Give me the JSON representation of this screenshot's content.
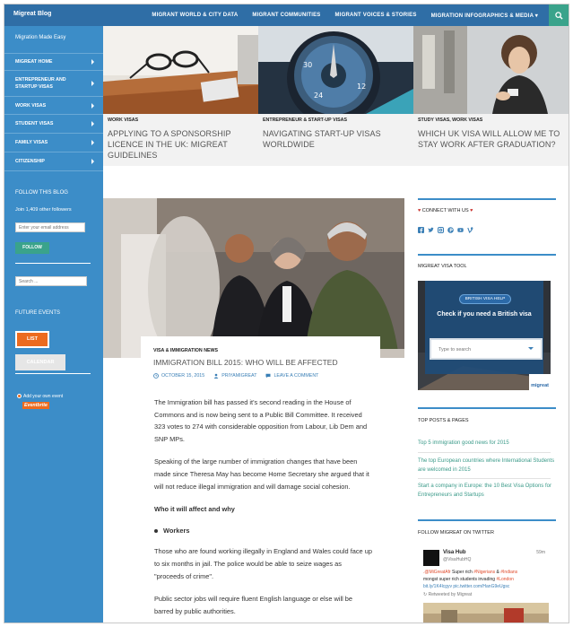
{
  "site": {
    "title": "Migreat Blog",
    "tagline": "Migration Made Easy"
  },
  "top_nav": [
    {
      "label": "MIGRANT WORLD & CITY DATA"
    },
    {
      "label": "MIGRANT COMMUNITIES"
    },
    {
      "label": "MIGRANT VOICES & STORIES"
    },
    {
      "label": "MIGRATION INFOGRAPHICS & MEDIA"
    }
  ],
  "side_menu": [
    {
      "label": "MIGREAT HOME"
    },
    {
      "label": "ENTREPRENEUR AND STARTUP VISAS"
    },
    {
      "label": "WORK VISAS"
    },
    {
      "label": "STUDENT VISAS"
    },
    {
      "label": "FAMILY VISAS"
    },
    {
      "label": "CITIZENSHIP"
    }
  ],
  "follow": {
    "heading": "FOLLOW THIS BLOG",
    "count_text": "Join 1,409 other followers",
    "email_placeholder": "Enter your email address",
    "button": "FOLLOW"
  },
  "side_search_placeholder": "Search ...",
  "events": {
    "heading": "FUTURE EVENTS",
    "list_button": "LIST",
    "calendar_button": "CALENDAR",
    "add_event": "Add your own event",
    "eventbrite": "Eventbrite"
  },
  "featured": [
    {
      "category": "WORK VISAS",
      "title": "APPLYING TO A SPONSORSHIP LICENCE IN THE UK: MIGREAT GUIDELINES"
    },
    {
      "category": "ENTREPRENEUR & START-UP VISAS",
      "title": "NAVIGATING START-UP VISAS WORLDWIDE"
    },
    {
      "category": "STUDY VISAS, WORK VISAS",
      "title": "WHICH UK VISA WILL ALLOW ME TO STAY WORK AFTER GRADUATION?"
    }
  ],
  "post": {
    "category": "VISA & IMMIGRATION NEWS",
    "title": "IMMIGRATION BILL 2015: WHO WILL BE AFFECTED",
    "date": "OCTOBER 15, 2015",
    "author": "PRIYAMIGREAT",
    "comment": "LEAVE A COMMENT",
    "p1": "The Immigration bill has passed it's second reading in the House of Commons and is now being sent to a Public Bill Committee. It received 323 votes to 274 with considerable opposition from Labour, Lib Dem and SNP MPs.",
    "p2": "Speaking of the large number of immigration changes that have been made since Theresa May has become Home Secretary she argued that it will not reduce illegal immigration and will damage social cohesion.",
    "h1": "Who it will affect and why",
    "bullet1": "Workers",
    "p3": "Those who are found working illegally in England and Wales could face up to six months in jail. The police would be able to seize wages as \"proceeds of crime\".",
    "p4": "Public sector jobs will require fluent English language or else will be barred by public authorities."
  },
  "right_sidebar": {
    "connect_title": "CONNECT WITH US",
    "social_icons": [
      "facebook-icon",
      "twitter-icon",
      "instagram-icon",
      "pinterest-icon",
      "youtube-icon",
      "vine-icon"
    ],
    "tool_title": "MIGREAT VISA TOOL",
    "tool_badge": "BRITISH VISA HELP",
    "tool_heading": "Check if you need a British visa",
    "tool_search_placeholder": "Type to search",
    "tool_logo": "migreat",
    "top_title": "TOP POSTS & PAGES",
    "top_posts": [
      "Top 5 immigration good news for 2015",
      "The top European countries where International Students are welcomed in 2015",
      "Start a company in Europe: the 10 Best Visa Options for Entrepreneurs and Startups"
    ],
    "twitter_title": "FOLLOW MIGREAT ON TWITTER",
    "tweet": {
      "name": "Visa Hub",
      "handle": "@VisaHubHQ",
      "time": "59m",
      "line1_a": ".@MiGreatAfr",
      "line1_b": " Super rich ",
      "line1_c": "#Nigerians",
      "line1_d": " & ",
      "line1_e": "#Indians",
      "line2_a": " mongst super rich students invading ",
      "line2_b": "#London",
      "line3": "bit.ly/1K4lcgyv pic.twitter.com/HanG9eUgsc",
      "retweet": "Retweeted by Migreat"
    }
  }
}
